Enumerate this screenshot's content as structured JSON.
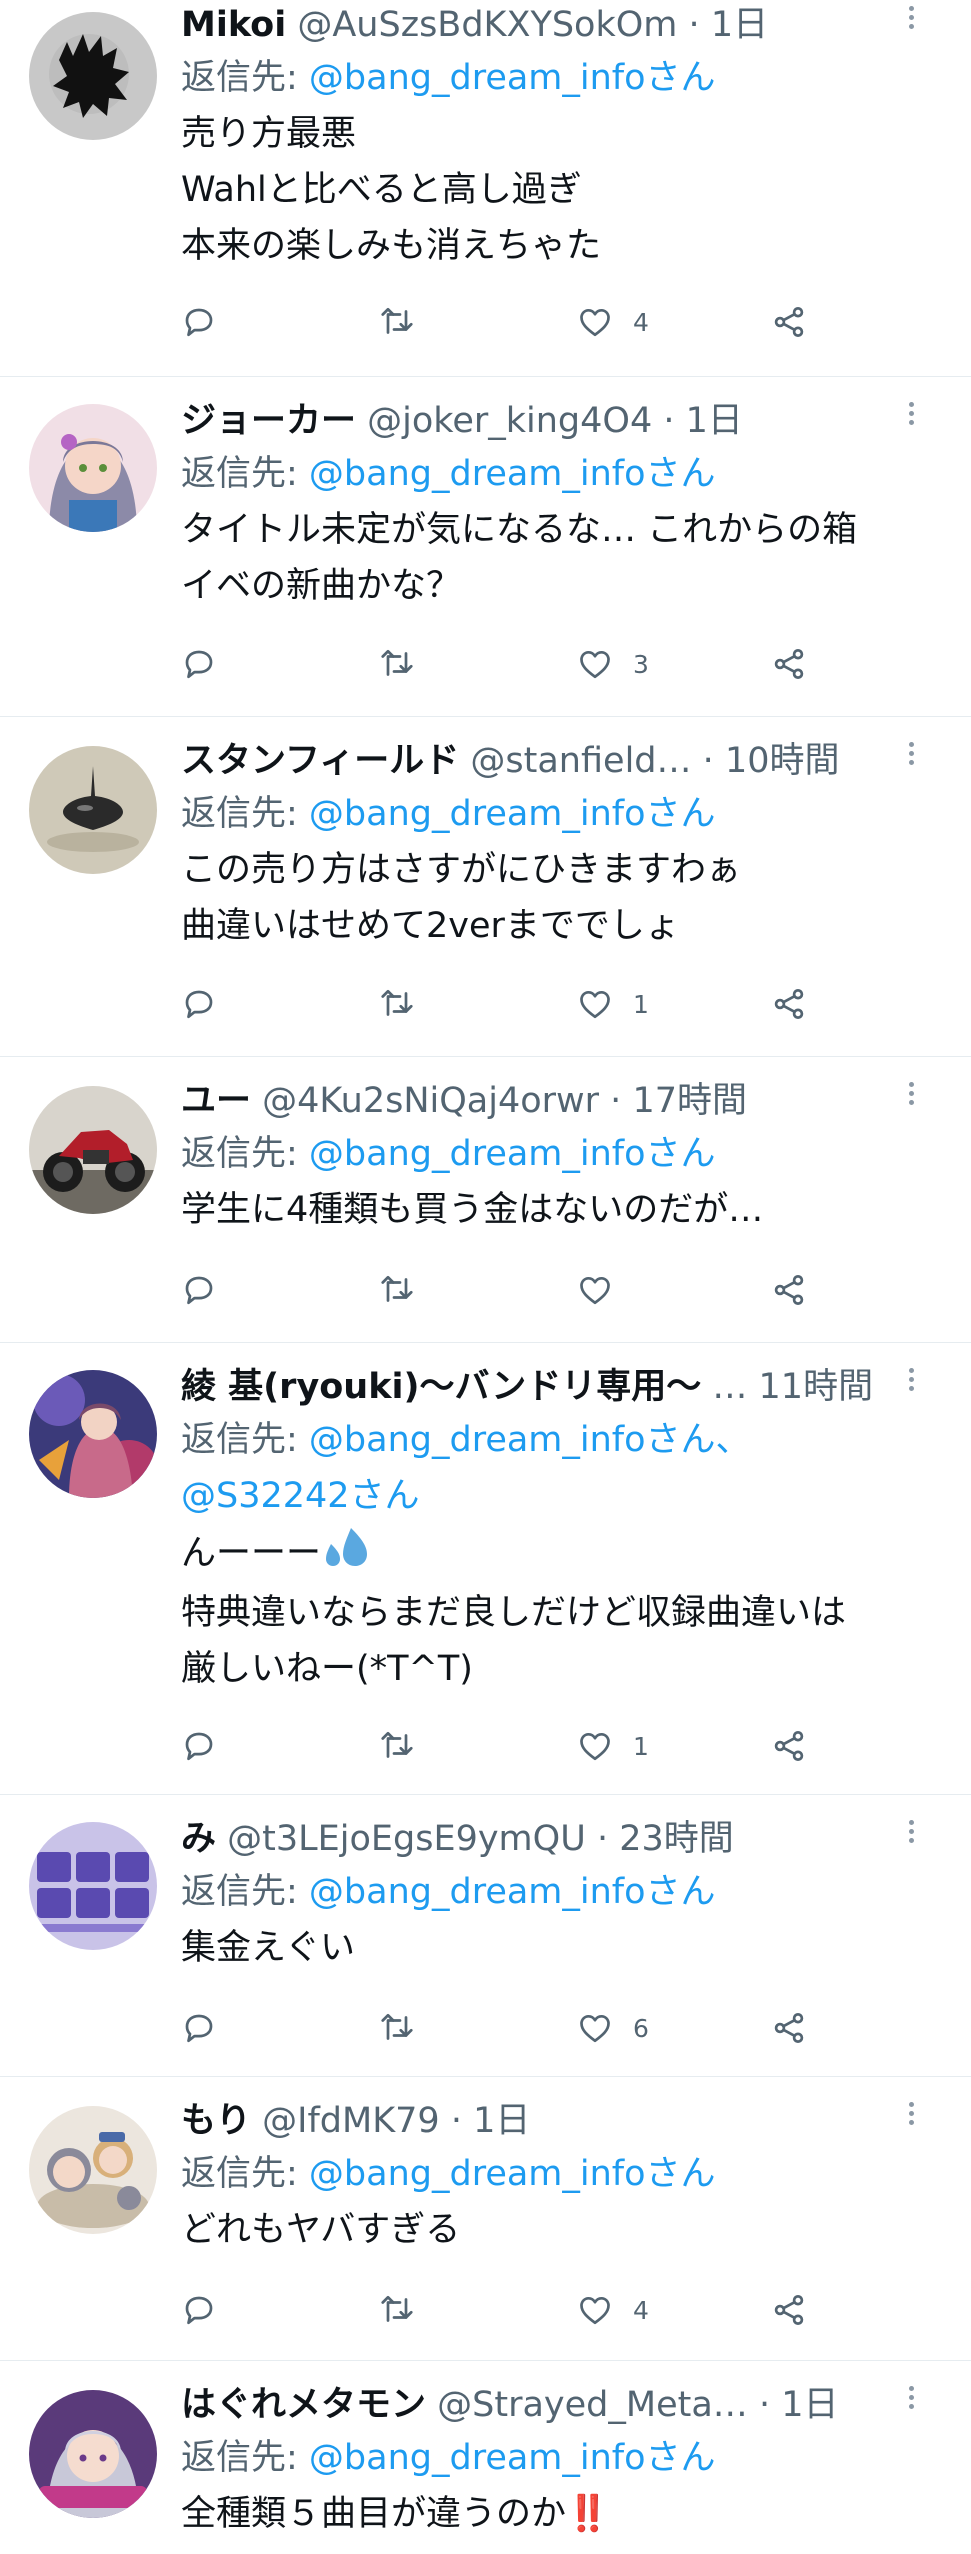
{
  "colors": {
    "accent": "#1d9bf0",
    "text": "#0f1419",
    "muted": "#536471",
    "border": "#e6ecf0",
    "like_red": "#e0202e"
  },
  "icons": {
    "reply": "reply-icon",
    "retweet": "retweet-icon",
    "like": "heart-icon",
    "share": "share-icon",
    "more": "more-vertical-icon"
  },
  "replies": [
    {
      "name": "Mikoi",
      "handle": "@AuSzsBdKXYSokOm",
      "sep": "·",
      "time": "1日",
      "reply_prefix": "返信先: ",
      "reply_mention": "@bang_dream_infoさん",
      "lines": [
        "売り方最悪",
        "Wahlと比べると高し過ぎ",
        "本来の楽しみも消えちゃた"
      ],
      "likes": "4"
    },
    {
      "name": "ジョーカー",
      "handle": "@joker_king4O4",
      "sep": "·",
      "time": "1日",
      "reply_prefix": "返信先: ",
      "reply_mention": "@bang_dream_infoさん",
      "lines": [
        "タイトル未定が気になるな… これからの箱",
        "イベの新曲かな？"
      ],
      "likes": "3"
    },
    {
      "name": "スタンフィールド",
      "handle": "@stanfield…",
      "sep": "·",
      "time": "10時間",
      "reply_prefix": "返信先: ",
      "reply_mention": "@bang_dream_infoさん",
      "lines": [
        "この売り方はさすがにひきますわぁ",
        "曲違いはせめて2verまででしょ"
      ],
      "likes": "1"
    },
    {
      "name": "ユー",
      "handle": "@4Ku2sNiQaj4orwr",
      "sep": "·",
      "time": "17時間",
      "reply_prefix": "返信先: ",
      "reply_mention": "@bang_dream_infoさん",
      "lines": [
        "学生に4種類も買う金はないのだが…"
      ],
      "likes": ""
    },
    {
      "name": "綾 基(ryouki)〜バンドリ専用〜",
      "handle": "…",
      "sep": "",
      "time": "11時間",
      "reply_prefix": "返信先: ",
      "reply_mention": "@bang_dream_infoさん、",
      "reply_mention_2": "@S32242さん",
      "lines": [
        "んーーー",
        "特典違いならまだ良しだけど収録曲違いは",
        "厳しいねー(*T^T)"
      ],
      "likes": "1"
    },
    {
      "name": "み",
      "handle": "@t3LEjoEgsE9ymQU",
      "sep": "·",
      "time": "23時間",
      "reply_prefix": "返信先: ",
      "reply_mention": "@bang_dream_infoさん",
      "lines": [
        "集金えぐい"
      ],
      "likes": "6"
    },
    {
      "name": "もり",
      "handle": "@IfdMK79",
      "sep": "·",
      "time": "1日",
      "reply_prefix": "返信先: ",
      "reply_mention": "@bang_dream_infoさん",
      "lines": [
        "どれもヤバすぎる"
      ],
      "likes": "4"
    },
    {
      "name": "はぐれメタモン",
      "handle": "@Strayed_Meta…",
      "sep": "·",
      "time": "1日",
      "reply_prefix": "返信先: ",
      "reply_mention": "@bang_dream_infoさん",
      "lines": [
        "全種類５曲目が違うのか",
        "‼️"
      ],
      "likes": ""
    }
  ]
}
